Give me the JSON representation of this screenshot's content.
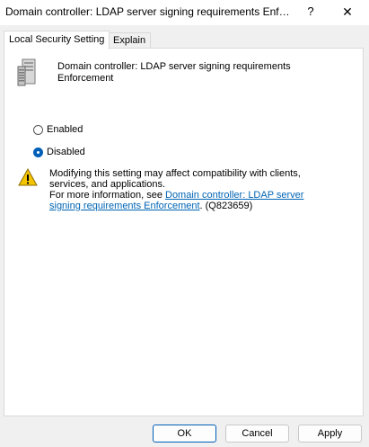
{
  "window": {
    "title": "Domain controller: LDAP server signing requirements Enf…",
    "help_label": "?",
    "close_label": "✕"
  },
  "tabs": [
    {
      "label": "Local Security Setting",
      "active": true
    },
    {
      "label": "Explain",
      "active": false
    }
  ],
  "policy": {
    "icon": "server-icon",
    "title": "Domain controller: LDAP server signing requirements Enforcement"
  },
  "options": [
    {
      "label": "Enabled",
      "selected": false
    },
    {
      "label": "Disabled",
      "selected": true
    }
  ],
  "warning": {
    "icon": "warning-icon",
    "text": "Modifying this setting may affect compatibility with clients, services, and applications.",
    "more_info_prefix": "For more information, see ",
    "link_text": "Domain controller: LDAP server signing requirements Enforcement",
    "suffix": ". (Q823659)"
  },
  "buttons": {
    "ok": "OK",
    "cancel": "Cancel",
    "apply": "Apply"
  },
  "colors": {
    "accent": "#005fb8",
    "link": "#0064b4",
    "warning": "#f5c400"
  }
}
